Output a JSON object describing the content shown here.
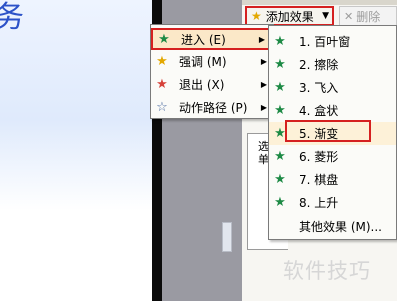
{
  "slide": {
    "title_fragment": "务"
  },
  "task_pane": {
    "add_effect_label": "添加效果",
    "delete_label": "删除",
    "left_label_line1": "选",
    "left_label_line2": "单"
  },
  "menu1": {
    "items": [
      {
        "label": "进入 (E)",
        "icon": "star-green-icon"
      },
      {
        "label": "强调 (M)",
        "icon": "star-yellow-icon"
      },
      {
        "label": "退出 (X)",
        "icon": "star-red-icon"
      },
      {
        "label": "动作路径 (P)",
        "icon": "star-outline-icon"
      }
    ]
  },
  "menu2": {
    "items": [
      {
        "label": "1. 百叶窗"
      },
      {
        "label": "2. 擦除"
      },
      {
        "label": "3. 飞入"
      },
      {
        "label": "4. 盒状"
      },
      {
        "label": "5. 渐变"
      },
      {
        "label": "6. 菱形"
      },
      {
        "label": "7. 棋盘"
      },
      {
        "label": "8. 上升"
      },
      {
        "label": "其他效果 (M)..."
      }
    ]
  },
  "watermark": "软件技巧",
  "colors": {
    "highlight_border": "#d52020",
    "star_green": "#1d8a45",
    "star_yellow": "#e3a800",
    "star_red": "#d6423a"
  }
}
